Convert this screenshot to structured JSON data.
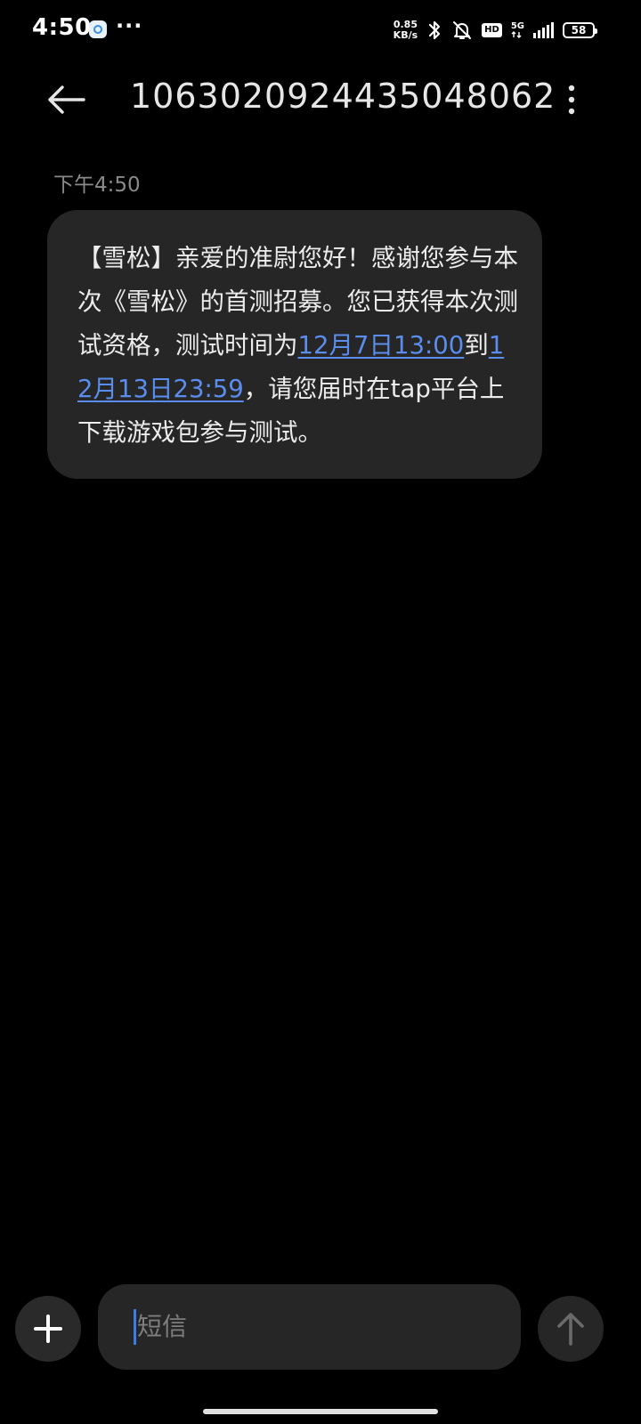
{
  "status_bar": {
    "time": "4:50",
    "overflow_dots": "···",
    "net_speed_value": "0.85",
    "net_speed_unit": "KB/s",
    "hd": "HD",
    "network_type": "5G",
    "battery": "58"
  },
  "header": {
    "title": "1063020924435048062"
  },
  "conversation": {
    "timestamp": "下午4:50",
    "message": {
      "text_part1": "【雪松】亲爱的准尉您好！感谢您参与本次《雪松》的首测招募。您已获得本次测试资格，测试时间为",
      "link1": "12月7日13:00",
      "text_part2": "到",
      "link2": "12月13日23:59",
      "text_part3": "，请您届时在tap平台上下载游戏包参与测试。"
    }
  },
  "composer": {
    "placeholder": "短信"
  },
  "icons": {
    "back": "arrow-left-icon",
    "menu": "more-vertical-icon",
    "add": "plus-icon",
    "send": "arrow-up-icon"
  },
  "colors": {
    "background": "#000000",
    "bubble": "#262626",
    "link": "#5b8def",
    "caret": "#3a7ce8"
  }
}
